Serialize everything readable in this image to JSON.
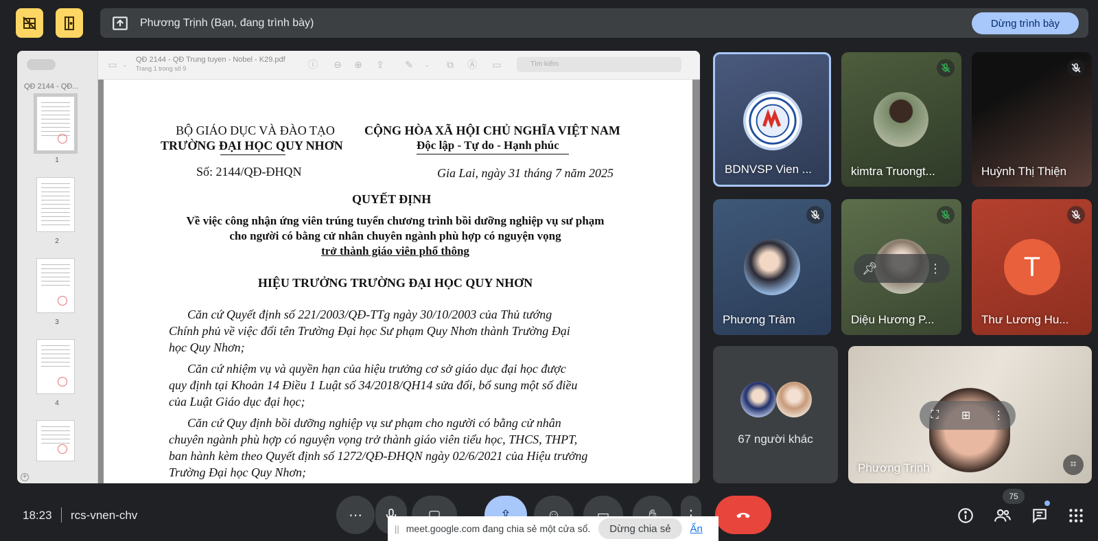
{
  "presentation_bar": {
    "presenter_text": "Phương Trịnh (Bạn, đang trình bày)",
    "stop_presenting_label": "Dừng trình bày"
  },
  "pdf_viewer": {
    "sidebar_title": "QĐ 2144 - QĐ...",
    "file_title": "QĐ 2144 - QĐ Trung tuyen - Nobel - K29.pdf",
    "page_indicator": "Trang 1 trong số 9",
    "search_placeholder": "Tìm kiếm",
    "thumbnails": [
      "1",
      "2",
      "3",
      "4"
    ],
    "document": {
      "ministry": "BỘ GIÁO DỤC VÀ ĐÀO TẠO",
      "school": "TRƯỜNG ĐẠI HỌC QUY NHƠN",
      "nation": "CỘNG HÒA XÃ HỘI CHỦ NGHĨA VIỆT NAM",
      "motto": "Độc lập - Tự do - Hạnh phúc",
      "doc_number": "Số: 2144/QĐ-ĐHQN",
      "doc_date": "Gia Lai, ngày 31 tháng 7 năm 2025",
      "heading": "QUYẾT ĐỊNH",
      "re_line1": "Về việc công nhận ứng viên trúng tuyển chương trình bồi dưỡng nghiệp vụ sư phạm",
      "re_line2": "cho người có bằng cử nhân chuyên ngành phù hợp có nguyện vọng",
      "re_line3": "trở thành giáo viên phổ thông",
      "principal": "HIỆU TRƯỞNG TRƯỜNG ĐẠI HỌC QUY NHƠN",
      "body": [
        "      Căn cứ Quyết định số 221/2003/QĐ-TTg ngày 30/10/2003 của Thủ tướng",
        "Chính phủ về việc đổi tên Trường Đại học Sư phạm Quy Nhơn thành Trường Đại",
        "học Quy Nhơn;",
        "      Căn cứ nhiệm vụ và quyền hạn của hiệu trưởng cơ sở giáo dục đại học được",
        "quy định tại Khoản 14 Điều 1 Luật số 34/2018/QH14 sửa đổi, bổ sung một số điều",
        "của Luật Giáo dục đại học;",
        "      Căn cứ Quy định bồi dưỡng nghiệp vụ sư phạm cho người có bằng cử nhân",
        "chuyên ngành phù hợp có nguyện vọng trở thành giáo viên tiểu học, THCS, THPT,",
        "ban hành kèm theo Quyết định số 1272/QĐ-ĐHQN ngày 02/6/2021 của Hiệu trưởng",
        "Trường Đại học Quy Nhơn;"
      ]
    }
  },
  "participants": {
    "bdnvsp": "BDNVSP Vien ...",
    "kimtra": "kimtra Truongt...",
    "huynh": "Huỳnh Thị Thiện",
    "phuong_tram": "Phương Trâm",
    "dieu_huong": "Diệu Hương P...",
    "thu_luong": "Thư Lương Hu...",
    "thu_initial": "T",
    "others": "67 người khác",
    "self": "Phương Trịnh"
  },
  "bottom_bar": {
    "time": "18:23",
    "meeting_code": "rcs-vnen-chv",
    "participant_count": "75",
    "share_notice_text": "meet.google.com đang chia sẻ một cửa sổ.",
    "stop_share_label": "Dừng chia sẻ",
    "hide_label": "Ẩn"
  },
  "colors": {
    "background": "#202124",
    "accent_yellow": "#fdd663",
    "accent_blue": "#a8c7fa",
    "hangup_red": "#e8453c",
    "mic_off_green": "#1e8e3e"
  }
}
